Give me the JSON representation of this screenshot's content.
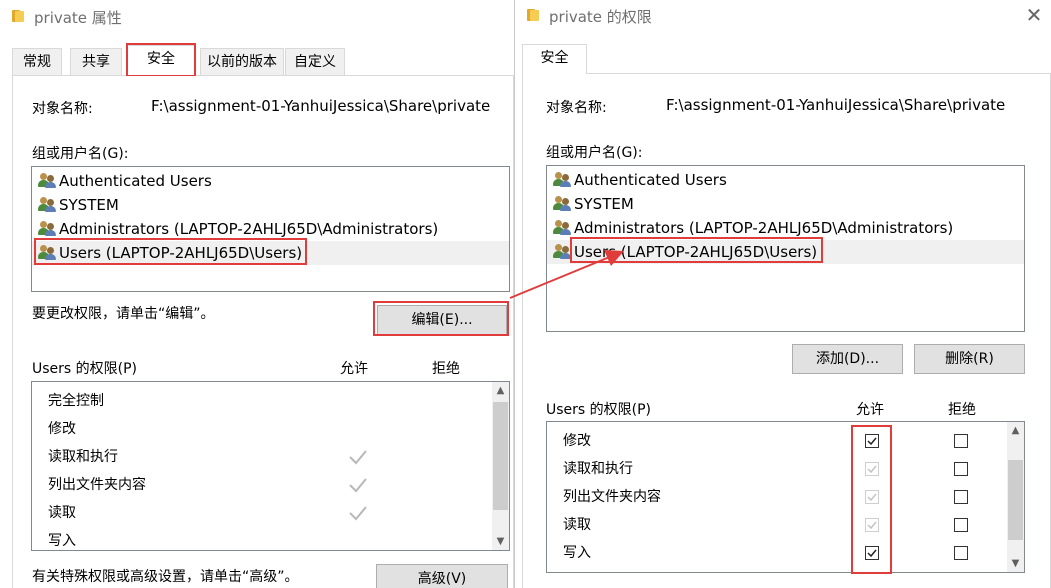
{
  "left_window": {
    "title": "private 属性",
    "tabs": [
      "常规",
      "共享",
      "安全",
      "以前的版本",
      "自定义"
    ],
    "active_tab": "安全",
    "object_name_label": "对象名称:",
    "object_name_value": "F:\\assignment-01-YanhuiJessica\\Share\\private",
    "groups_label": "组或用户名(G):",
    "groups": [
      "Authenticated Users",
      "SYSTEM",
      "Administrators (LAPTOP-2AHLJ65D\\Administrators)",
      "Users (LAPTOP-2AHLJ65D\\Users)"
    ],
    "selected_group": "Users (LAPTOP-2AHLJ65D\\Users)",
    "change_hint": "要更改权限，请单击“编辑”。",
    "edit_button": "编辑(E)...",
    "perm_label": "Users 的权限(P)",
    "allow_header": "允许",
    "deny_header": "拒绝",
    "permissions": [
      {
        "name": "完全控制",
        "allow": false,
        "deny": false
      },
      {
        "name": "修改",
        "allow": false,
        "deny": false
      },
      {
        "name": "读取和执行",
        "allow": true,
        "deny": false
      },
      {
        "name": "列出文件夹内容",
        "allow": true,
        "deny": false
      },
      {
        "name": "读取",
        "allow": true,
        "deny": false
      },
      {
        "name": "写入",
        "allow": false,
        "deny": false
      }
    ],
    "advanced_hint": "有关特殊权限或高级设置，请单击“高级”。",
    "advanced_button": "高级(V)"
  },
  "right_window": {
    "title": "private 的权限",
    "tabs": [
      "安全"
    ],
    "object_name_label": "对象名称:",
    "object_name_value": "F:\\assignment-01-YanhuiJessica\\Share\\private",
    "groups_label": "组或用户名(G):",
    "groups": [
      "Authenticated Users",
      "SYSTEM",
      "Administrators (LAPTOP-2AHLJ65D\\Administrators)",
      "Users (LAPTOP-2AHLJ65D\\Users)"
    ],
    "selected_group": "Users (LAPTOP-2AHLJ65D\\Users)",
    "add_button": "添加(D)...",
    "remove_button": "删除(R)",
    "perm_label": "Users 的权限(P)",
    "allow_header": "允许",
    "deny_header": "拒绝",
    "permissions": [
      {
        "name": "修改",
        "allow": "checked",
        "deny": "unchecked"
      },
      {
        "name": "读取和执行",
        "allow": "inherited",
        "deny": "unchecked"
      },
      {
        "name": "列出文件夹内容",
        "allow": "inherited",
        "deny": "unchecked"
      },
      {
        "name": "读取",
        "allow": "inherited",
        "deny": "unchecked"
      },
      {
        "name": "写入",
        "allow": "checked",
        "deny": "unchecked"
      }
    ]
  },
  "colors": {
    "highlight_red": "#e03c3c",
    "folder_yellow": "#f6cd52",
    "selection_grey": "#f0f0f0"
  }
}
